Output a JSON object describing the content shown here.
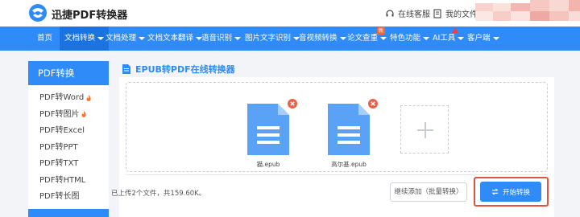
{
  "header": {
    "brand": "迅捷PDF转换器",
    "support": "在线客服",
    "my_files": "我的文件"
  },
  "nav": {
    "items": [
      {
        "label": "首页"
      },
      {
        "label": "文档转换"
      },
      {
        "label": "文档处理"
      },
      {
        "label": "文档文本翻译"
      },
      {
        "label": "语音识别"
      },
      {
        "label": "图片文字识别"
      },
      {
        "label": "音视频转换"
      },
      {
        "label": "论文查重"
      },
      {
        "label": "特色功能"
      },
      {
        "label": "AI工具"
      },
      {
        "label": "客户端"
      }
    ],
    "new_badge": "新"
  },
  "sidebar": {
    "title": "PDF转换",
    "items": [
      {
        "label": "PDF转Word"
      },
      {
        "label": "PDF转图片"
      },
      {
        "label": "PDF转Excel"
      },
      {
        "label": "PDF转PPT"
      },
      {
        "label": "PDF转TXT"
      },
      {
        "label": "PDF转HTML"
      },
      {
        "label": "PDF转长图"
      }
    ]
  },
  "main": {
    "title": "EPUB转PDF在线转换器",
    "files": [
      {
        "name": "猫.epub"
      },
      {
        "name": "高尔基.epub"
      }
    ],
    "status": "已上传2个文件，共159.60K。",
    "continue_label": "继续添加（批量转换）",
    "start_label": "开始转换"
  },
  "colors": {
    "accent": "#2f8bf7",
    "highlight": "#e2523c",
    "remove": "#e8624a"
  }
}
